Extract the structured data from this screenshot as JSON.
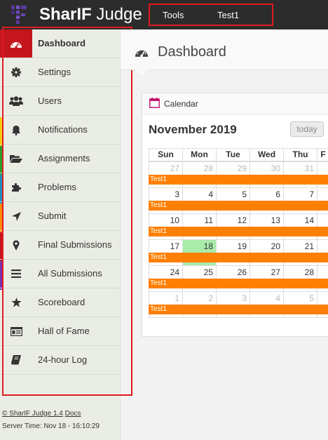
{
  "brand": {
    "name_bold": "SharIF",
    "name_rest": " Judge"
  },
  "top_menu": {
    "tools": "Tools",
    "test1": "Test1"
  },
  "sidebar": {
    "items": [
      {
        "label": "Dashboard",
        "icon": "dashboard-icon",
        "active": true
      },
      {
        "label": "Settings",
        "icon": "gear-icon"
      },
      {
        "label": "Users",
        "icon": "users-icon"
      },
      {
        "label": "Notifications",
        "icon": "bell-icon"
      },
      {
        "label": "Assignments",
        "icon": "folder-open-icon"
      },
      {
        "label": "Problems",
        "icon": "puzzle-icon"
      },
      {
        "label": "Submit",
        "icon": "location-arrow-icon"
      },
      {
        "label": "Final Submissions",
        "icon": "map-marker-icon"
      },
      {
        "label": "All Submissions",
        "icon": "list-icon"
      },
      {
        "label": "Scoreboard",
        "icon": "star-icon"
      },
      {
        "label": "Hall of Fame",
        "icon": "id-card-icon"
      },
      {
        "label": "24-hour Log",
        "icon": "book-icon"
      }
    ]
  },
  "footer": {
    "copyright": "© SharIF Judge 1.4",
    "docs": "Docs",
    "server_time": "Server Time: Nov 18 - 16:10:29"
  },
  "page": {
    "title": "Dashboard"
  },
  "calendar": {
    "header": "Calendar",
    "month": "November 2019",
    "today_button": "today",
    "days_of_week": [
      "Sun",
      "Mon",
      "Tue",
      "Wed",
      "Thu",
      "F"
    ],
    "weeks": [
      [
        {
          "d": "27",
          "other": true
        },
        {
          "d": "28",
          "other": true
        },
        {
          "d": "29",
          "other": true
        },
        {
          "d": "30",
          "other": true
        },
        {
          "d": "31",
          "other": true
        },
        {
          "d": "",
          "other": true
        }
      ],
      [
        {
          "d": "3"
        },
        {
          "d": "4"
        },
        {
          "d": "5"
        },
        {
          "d": "6"
        },
        {
          "d": "7"
        },
        {
          "d": ""
        }
      ],
      [
        {
          "d": "10"
        },
        {
          "d": "11"
        },
        {
          "d": "12"
        },
        {
          "d": "13"
        },
        {
          "d": "14"
        },
        {
          "d": ""
        }
      ],
      [
        {
          "d": "17"
        },
        {
          "d": "18",
          "today": true
        },
        {
          "d": "19"
        },
        {
          "d": "20"
        },
        {
          "d": "21"
        },
        {
          "d": ""
        }
      ],
      [
        {
          "d": "24"
        },
        {
          "d": "25"
        },
        {
          "d": "26"
        },
        {
          "d": "27"
        },
        {
          "d": "28"
        },
        {
          "d": ""
        }
      ],
      [
        {
          "d": "1",
          "other": true
        },
        {
          "d": "2",
          "other": true
        },
        {
          "d": "3",
          "other": true
        },
        {
          "d": "4",
          "other": true
        },
        {
          "d": "5",
          "other": true
        },
        {
          "d": "",
          "other": true
        }
      ]
    ],
    "event_label": "Test1",
    "event_color": "#ff7f00",
    "today_color": "#a8ecaa"
  },
  "colors": {
    "topbar": "#2c2c2c",
    "accent": "#c4161c",
    "outline": "#e01b22"
  }
}
